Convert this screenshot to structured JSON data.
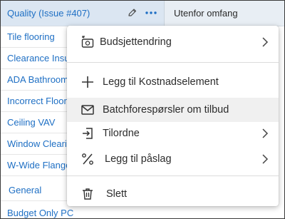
{
  "header": {
    "title": "Quality (Issue #407)",
    "right_text": "Utenfor omfang"
  },
  "list": {
    "items": [
      {
        "label": "Tile flooring"
      },
      {
        "label": "Clearance Insu"
      },
      {
        "label": "ADA Bathroom"
      },
      {
        "label": "Incorrect Floor"
      },
      {
        "label": "Ceiling VAV"
      },
      {
        "label": "Window Cleari"
      },
      {
        "label": "W-Wide Flange"
      },
      {
        "label": "General"
      },
      {
        "label": "Budget Only PC"
      }
    ]
  },
  "menu": {
    "items": [
      {
        "label": "Budsjettendring",
        "icon": "budget-change-icon",
        "submenu": true
      },
      {
        "label": "Legg til Kostnadselement",
        "icon": "plus-icon",
        "submenu": false
      },
      {
        "label": "Batchforespørsler om tilbud",
        "icon": "envelope-icon",
        "submenu": false,
        "highlighted": true
      },
      {
        "label": "Tilordne",
        "icon": "assign-icon",
        "submenu": true
      },
      {
        "label": "Legg til påslag",
        "icon": "percent-icon",
        "submenu": true
      },
      {
        "label": "Slett",
        "icon": "trash-icon",
        "submenu": false
      }
    ]
  },
  "colors": {
    "link": "#1e6fc4",
    "header_bg": "#dbe6f2",
    "highlight": "#f0f0f0"
  }
}
